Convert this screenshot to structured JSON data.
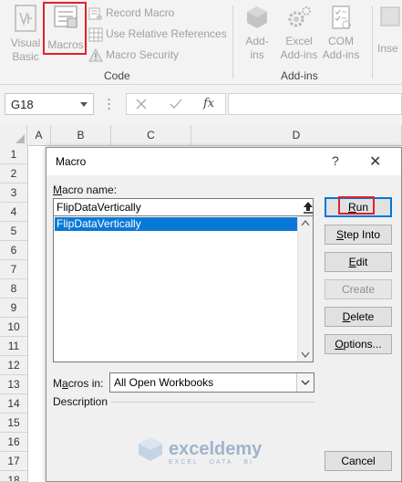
{
  "ribbon": {
    "visual_basic_label_1": "Visual",
    "visual_basic_label_2": "Basic",
    "macros_label": "Macros",
    "record_macro": "Record Macro",
    "use_relative_references": "Use Relative References",
    "macro_security": "Macro Security",
    "code_group": "Code",
    "addins_label_1": "Add-",
    "addins_label_2": "ins",
    "excel_addins_label_1": "Excel",
    "excel_addins_label_2": "Add-ins",
    "com_addins_label_1": "COM",
    "com_addins_label_2": "Add-ins",
    "addins_group": "Add-ins",
    "insert_label": "Inse"
  },
  "formula_bar": {
    "name_box": "G18",
    "fx": "fx"
  },
  "grid": {
    "columns": [
      "A",
      "B",
      "C",
      "D"
    ],
    "rows": [
      "1",
      "2",
      "3",
      "4",
      "5",
      "6",
      "7",
      "8",
      "9",
      "10",
      "11",
      "12",
      "13",
      "14",
      "15",
      "16",
      "17",
      "18"
    ]
  },
  "dialog": {
    "title": "Macro",
    "help": "?",
    "close": "✕",
    "macro_name_label": "Macro name:",
    "macro_name_value": "FlipDataVertically",
    "macros_list": [
      "FlipDataVertically"
    ],
    "macros_in_label": "Macros in:",
    "macros_in_value": "All Open Workbooks",
    "description_label": "Description",
    "buttons": {
      "run": "Run",
      "step_into": "Step Into",
      "edit": "Edit",
      "create": "Create",
      "delete": "Delete",
      "options": "Options...",
      "cancel": "Cancel"
    }
  },
  "watermark": {
    "name": "exceldemy",
    "tagline": "EXCEL · DATA · BI"
  },
  "colors": {
    "highlight_red": "#e0202c",
    "selection_blue": "#0a78d7",
    "focus_blue": "#0078d7"
  }
}
